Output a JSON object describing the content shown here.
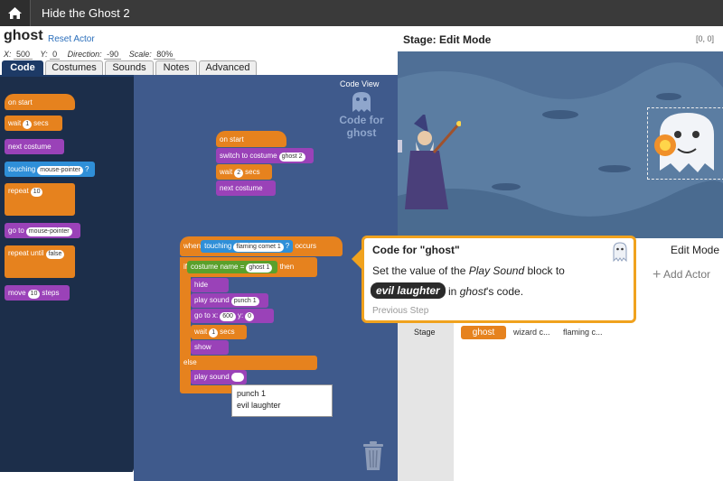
{
  "topbar": {
    "home_icon": "home-icon",
    "title": "Hide the Ghost 2"
  },
  "actor": {
    "name": "ghost",
    "reset_label": "Reset Actor",
    "x_label": "X:",
    "x_value": "500",
    "y_label": "Y:",
    "y_value": "0",
    "direction_label": "Direction:",
    "direction_value": "-90",
    "scale_label": "Scale:",
    "scale_value": "80%"
  },
  "tabs": [
    "Code",
    "Costumes",
    "Sounds",
    "Notes",
    "Advanced"
  ],
  "palette": {
    "on_start": "on start",
    "wait": "wait",
    "wait_val": "1",
    "secs": "secs",
    "next_costume": "next costume",
    "touching": "touching",
    "touching_val": "mouse-pointer",
    "q": "?",
    "repeat": "repeat",
    "repeat_val": "10",
    "goto": "go to",
    "goto_val": "mouse-pointer",
    "repeat_until": "repeat until",
    "repeat_until_val": "false",
    "move": "move",
    "move_val": "10",
    "steps": "steps"
  },
  "canvas": {
    "code_view": "Code View",
    "watermark_line1": "Code for",
    "watermark_line2": "ghost",
    "script1": {
      "on_start": "on start",
      "switch": "switch to costume",
      "switch_val": "ghost 2",
      "wait": "wait",
      "wait_val": "2",
      "secs": "secs",
      "next": "next costume"
    },
    "script2": {
      "when": "when",
      "touching": "touching",
      "touching_val": "flaming comet 1",
      "q": "?",
      "occurs": "occurs",
      "if": "if",
      "costume_name": "costume name",
      "eq": "=",
      "costume_val": "ghost 1",
      "then": "then",
      "hide": "hide",
      "play_sound": "play sound",
      "play_sound_val": "punch 1",
      "goto_x": "go to x:",
      "goto_x_val": "600",
      "y": "y:",
      "goto_y_val": "0",
      "wait": "wait",
      "wait_val": "1",
      "secs": "secs",
      "show": "show",
      "else": "else",
      "play_sound2": "play sound",
      "play_sound2_val": ""
    },
    "dropdown_options": [
      "punch 1",
      "evil laughter"
    ]
  },
  "stage": {
    "title": "Stage: Edit Mode",
    "coord": "[0, 0]"
  },
  "panel": {
    "edit_mode": "Edit Mode",
    "add_actor": "Add Actor",
    "stage_label": "Stage",
    "actors": [
      "ghost",
      "wizard c...",
      "flaming c..."
    ]
  },
  "tooltip": {
    "title": "Code for \"ghost\"",
    "line1_prefix": "Set the value of the ",
    "line1_em": "Play Sound",
    "line1_suffix": " block to",
    "chip": "evil laughter",
    "line2_prefix": " in ",
    "line2_em": "ghost",
    "line2_suffix": "'s code.",
    "prev": "Previous Step"
  },
  "colors": {
    "accent": "#f0a21e",
    "tab_active": "#1d3a66",
    "palette_bg": "#1c2e4a",
    "canvas_bg": "#3f5a8c"
  }
}
